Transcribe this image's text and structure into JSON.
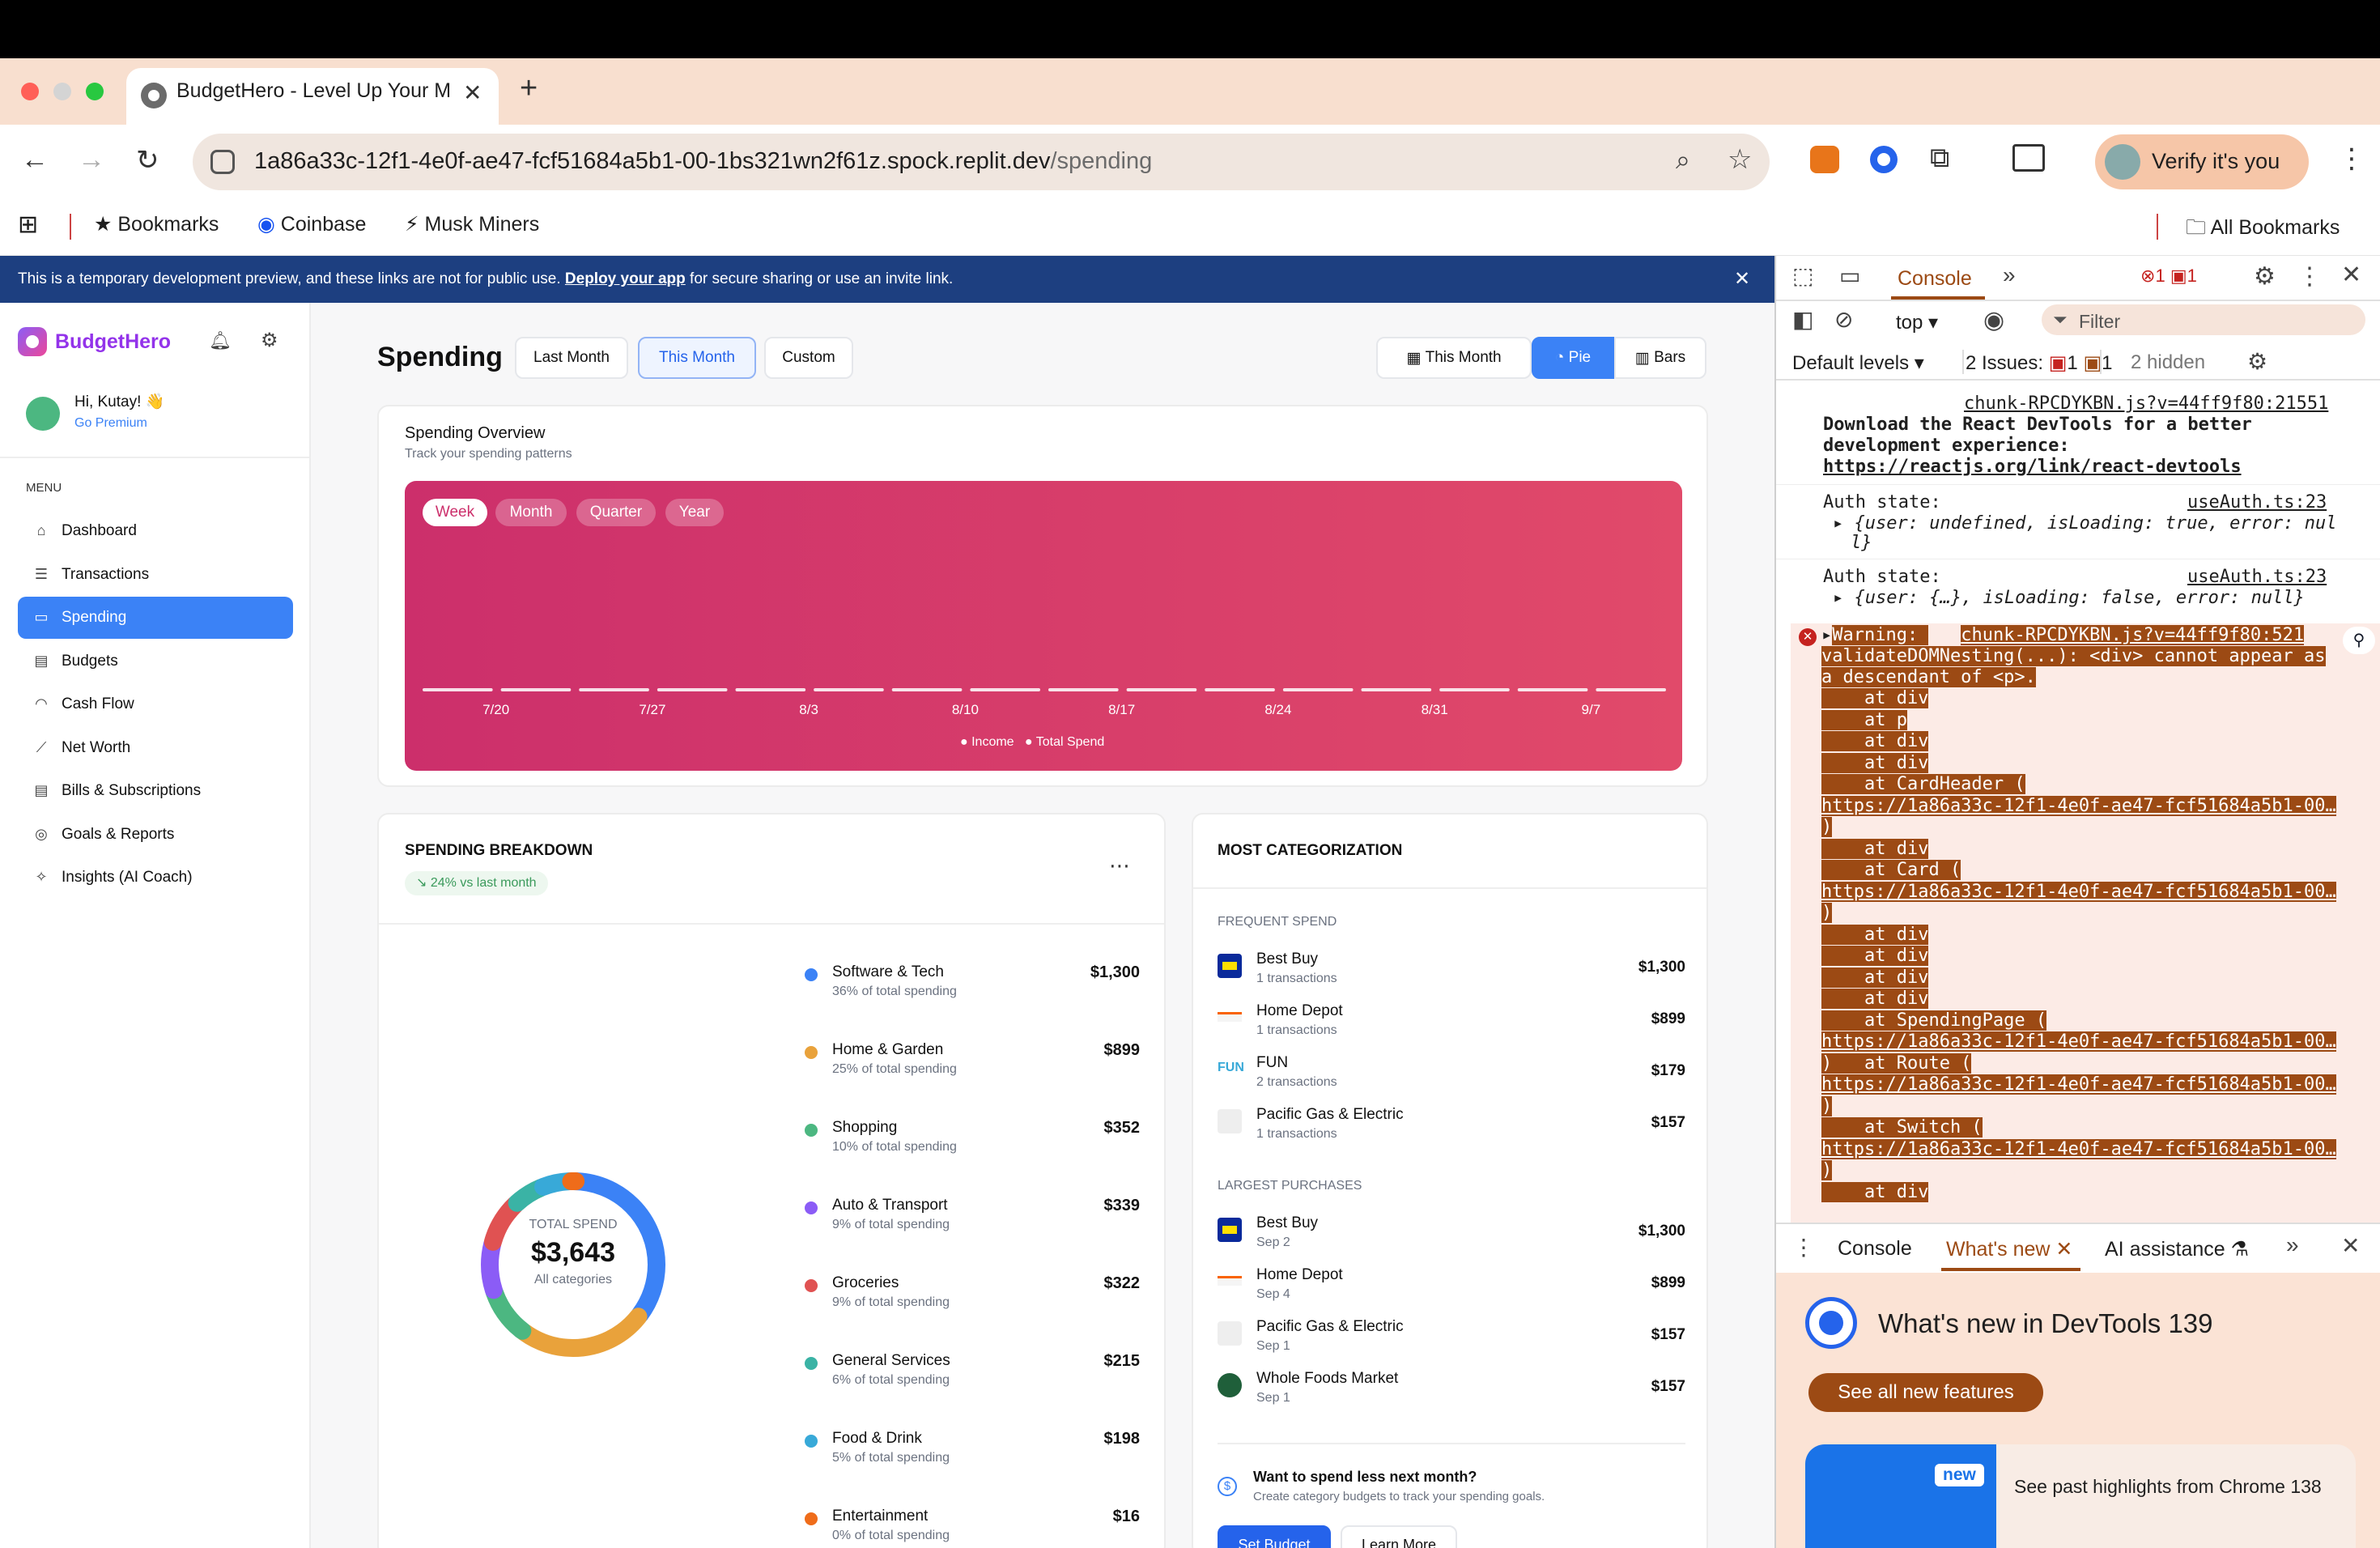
{
  "browser": {
    "tab_title": "BudgetHero - Level Up Your Money",
    "url_host": "1a86a33c-12f1-4e0f-ae47-fcf51684a5b1-00-1bs321wn2f61z.spock.replit.dev",
    "url_path": "/spending",
    "profile_label": "Verify it's you",
    "bookmarks": [
      "Bookmarks",
      "Coinbase",
      "Musk Miners"
    ],
    "all_bookmarks": "All Bookmarks"
  },
  "banner": {
    "text_before": "This is a temporary development preview, and these links are not for public use.",
    "link": "Deploy your app",
    "text_after": "for secure sharing or use an invite link."
  },
  "sidebar": {
    "brand": "BudgetHero",
    "greeting": "Hi, Kutay! 👋",
    "premium": "Go Premium",
    "menu_label": "MENU",
    "items": [
      {
        "label": "Dashboard",
        "icon": "home-icon"
      },
      {
        "label": "Transactions",
        "icon": "list-icon"
      },
      {
        "label": "Spending",
        "icon": "wallet-icon"
      },
      {
        "label": "Budgets",
        "icon": "budget-icon"
      },
      {
        "label": "Cash Flow",
        "icon": "gauge-icon"
      },
      {
        "label": "Net Worth",
        "icon": "chart-line-icon"
      },
      {
        "label": "Bills & Subscriptions",
        "icon": "receipt-icon"
      },
      {
        "label": "Goals & Reports",
        "icon": "target-icon"
      },
      {
        "label": "Insights (AI Coach)",
        "icon": "sparkle-icon"
      }
    ]
  },
  "header": {
    "title": "Spending",
    "ranges": [
      "Last Month",
      "This Month",
      "Custom"
    ],
    "date_button": "This Month",
    "view_pie": "Pie",
    "view_bars": "Bars"
  },
  "overview": {
    "title": "Spending Overview",
    "subtitle": "Track your spending patterns",
    "periods": [
      "Week",
      "Month",
      "Quarter",
      "Year"
    ],
    "legend": [
      "Income",
      "Total Spend"
    ]
  },
  "chart_data": [
    {
      "type": "bar",
      "title": "Spending Overview",
      "categories": [
        "7/20",
        "7/27",
        "8/3",
        "8/10",
        "8/17",
        "8/24",
        "8/31",
        "9/7"
      ],
      "series": [
        {
          "name": "Income",
          "values": [
            0,
            0,
            0,
            0,
            0,
            0,
            0,
            0
          ]
        },
        {
          "name": "Total Spend",
          "values": [
            0,
            0,
            0,
            0,
            0,
            0,
            0,
            0
          ]
        }
      ],
      "grid": false,
      "legend": "bottom"
    },
    {
      "type": "pie",
      "title": "",
      "categories": [
        "Software & Tech",
        "Home & Garden",
        "Shopping",
        "Auto & Transport",
        "Groceries",
        "General Services",
        "Food & Drink",
        "Entertainment"
      ],
      "values": [
        1300,
        899,
        352,
        339,
        322,
        215,
        198,
        16
      ],
      "colors": [
        "#3b82f6",
        "#e9a23b",
        "#4cb781",
        "#8b5cf6",
        "#e05252",
        "#3ab3a5",
        "#38a9d8",
        "#ef6c1a"
      ],
      "center_label": "TOTAL SPEND",
      "center_value": "$3,643",
      "center_sub": "All categories"
    }
  ],
  "breakdown": {
    "title": "SPENDING BREAKDOWN",
    "trend": "↘ 24% vs last month",
    "rows": [
      {
        "name": "Software & Tech",
        "pct": "36% of total spending",
        "amount": "$1,300",
        "color": "#3b82f6"
      },
      {
        "name": "Home & Garden",
        "pct": "25% of total spending",
        "amount": "$899",
        "color": "#e9a23b"
      },
      {
        "name": "Shopping",
        "pct": "10% of total spending",
        "amount": "$352",
        "color": "#4cb781"
      },
      {
        "name": "Auto & Transport",
        "pct": "9% of total spending",
        "amount": "$339",
        "color": "#8b5cf6"
      },
      {
        "name": "Groceries",
        "pct": "9% of total spending",
        "amount": "$322",
        "color": "#e05252"
      },
      {
        "name": "General Services",
        "pct": "6% of total spending",
        "amount": "$215",
        "color": "#3ab3a5"
      },
      {
        "name": "Food & Drink",
        "pct": "5% of total spending",
        "amount": "$198",
        "color": "#38a9d8"
      },
      {
        "name": "Entertainment",
        "pct": "0% of total spending",
        "amount": "$16",
        "color": "#ef6c1a"
      }
    ]
  },
  "categorization": {
    "title": "MOST CATEGORIZATION",
    "frequent_label": "FREQUENT SPEND",
    "frequent": [
      {
        "name": "Best Buy",
        "sub": "1 transactions",
        "amount": "$1,300",
        "logo": "bestbuy-logo"
      },
      {
        "name": "Home Depot",
        "sub": "1 transactions",
        "amount": "$899",
        "logo": "homedepot-logo"
      },
      {
        "name": "FUN",
        "sub": "2 transactions",
        "amount": "$179",
        "logo": "fun-logo"
      },
      {
        "name": "Pacific Gas & Electric",
        "sub": "1 transactions",
        "amount": "$157",
        "logo": "pge-logo"
      }
    ],
    "largest_label": "LARGEST PURCHASES",
    "largest": [
      {
        "name": "Best Buy",
        "sub": "Sep 2",
        "amount": "$1,300",
        "logo": "bestbuy-logo"
      },
      {
        "name": "Home Depot",
        "sub": "Sep 4",
        "amount": "$899",
        "logo": "homedepot-logo"
      },
      {
        "name": "Pacific Gas & Electric",
        "sub": "Sep 1",
        "amount": "$157",
        "logo": "pge-logo"
      },
      {
        "name": "Whole Foods Market",
        "sub": "Sep 1",
        "amount": "$157",
        "logo": "wholefoods-logo"
      }
    ],
    "tip_title": "Want to spend less next month?",
    "tip_sub": "Create category budgets to track your spending goals.",
    "set_budget": "Set Budget",
    "learn_more": "Learn More"
  },
  "devtools": {
    "tab_console": "Console",
    "error_count": "1",
    "issue_count": "1",
    "context": "top",
    "filter_placeholder": "Filter",
    "levels": "Default levels",
    "issues_label": "2 Issues:",
    "issues_err": "1",
    "issues_msg": "1",
    "hidden": "2 hidden",
    "log1_src": "chunk-RPCDYKBN.js?v=44ff9f80:21551",
    "log1_l1": "Download the React DevTools for a better",
    "log1_l2": "development experience:",
    "log1_link": "https://reactjs.org/link/react-devtools",
    "auth1_label": "Auth state:",
    "auth1_src": "useAuth.ts:23",
    "auth1_obj": "{user: undefined, isLoading: true, error: nul",
    "auth1_obj2": "l}",
    "auth2_label": "Auth state:",
    "auth2_src": "useAuth.ts:23",
    "auth2_obj": "{user: {…}, isLoading: false, error: null}",
    "warn_head": "Warning: ",
    "warn_src": "chunk-RPCDYKBN.js?v=44ff9f80:521",
    "warn_l2": "validateDOMNesting(...): <div> cannot appear as",
    "warn_l3": "a descendant of <p>.",
    "stack": [
      "    at div",
      "    at p",
      "    at div",
      "    at div",
      "    at CardHeader (",
      "https://1a86a33c-12f1-4e0f-ae47-fcf51684a5b1-00…",
      ")",
      "    at div",
      "    at Card (",
      "https://1a86a33c-12f1-4e0f-ae47-fcf51684a5b1-00…",
      ")",
      "    at div",
      "    at div",
      "    at div",
      "    at div",
      "    at SpendingPage (",
      "https://1a86a33c-12f1-4e0f-ae47-fcf51684a5b1-00…",
      ")   at Route (",
      "https://1a86a33c-12f1-4e0f-ae47-fcf51684a5b1-00…",
      ")",
      "    at Switch (",
      "https://1a86a33c-12f1-4e0f-ae47-fcf51684a5b1-00…",
      ")",
      "    at div"
    ],
    "drawer_console": "Console",
    "drawer_whatsnew": "What's new",
    "drawer_ai": "AI assistance",
    "whatsnew_title": "What's new in DevTools 139",
    "see_all": "See all new features",
    "new_badge": "new",
    "highlights": "See past highlights from Chrome 138"
  }
}
